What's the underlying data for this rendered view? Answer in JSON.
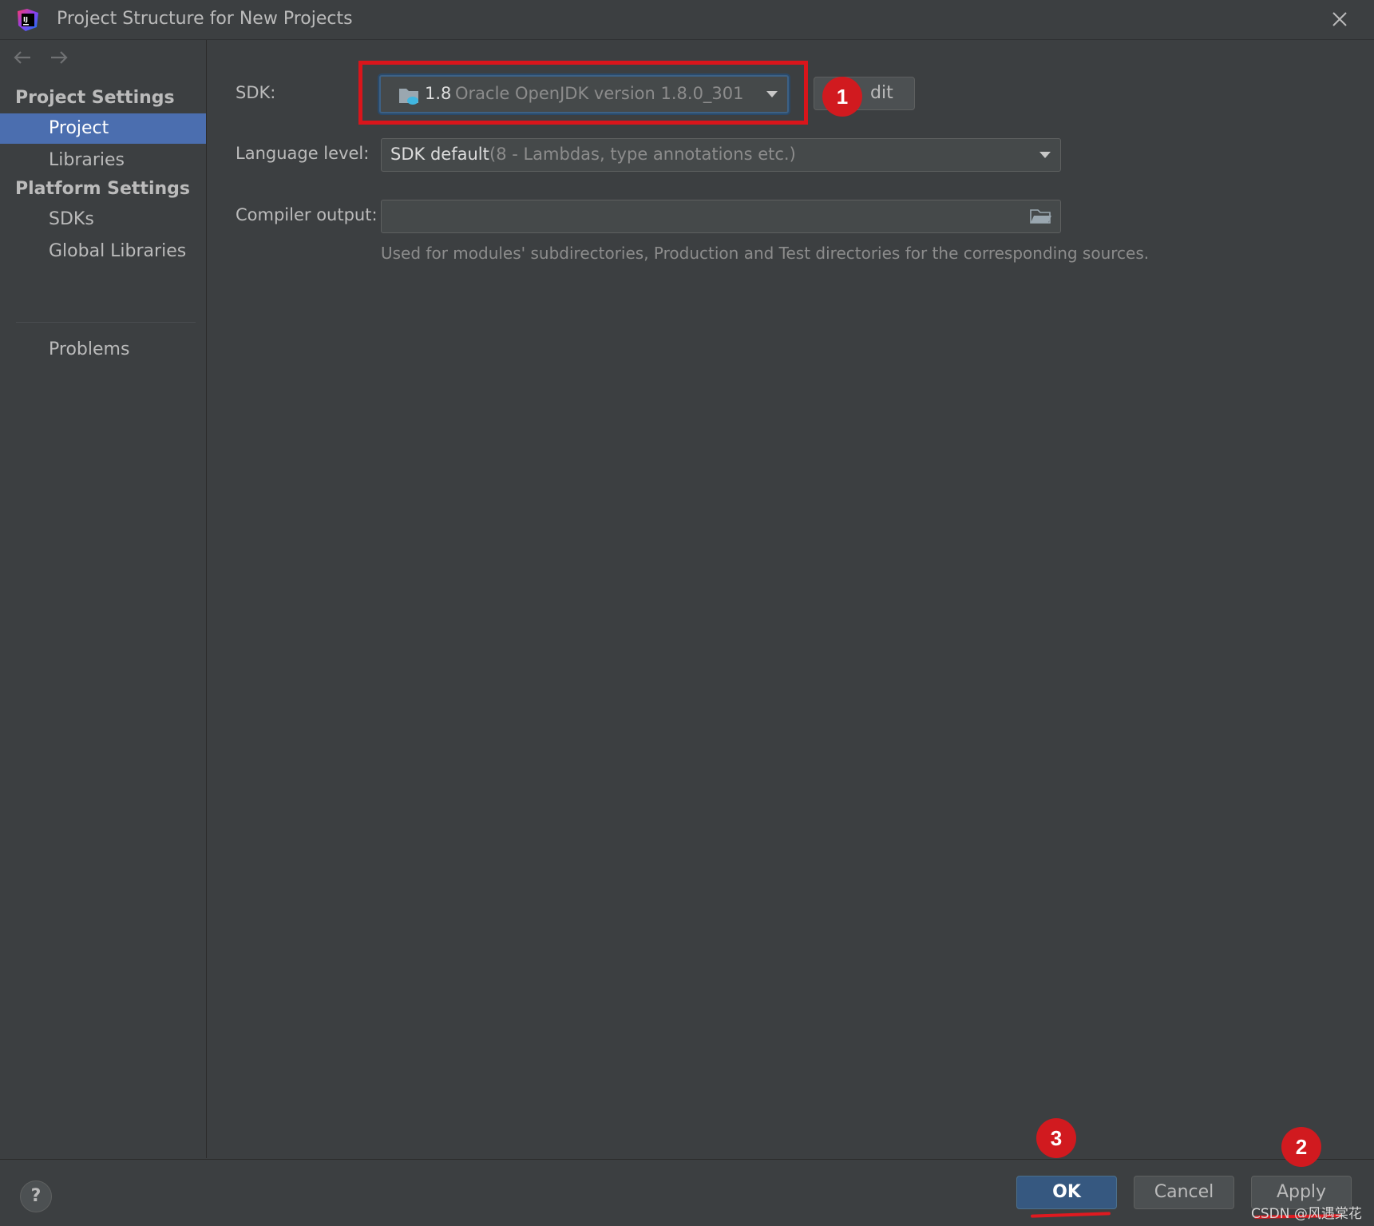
{
  "window": {
    "title": "Project Structure for New Projects"
  },
  "sidebar": {
    "project_settings_header": "Project Settings",
    "platform_settings_header": "Platform Settings",
    "items": [
      {
        "label": "Project",
        "selected": true
      },
      {
        "label": "Libraries",
        "selected": false
      },
      {
        "label": "SDKs",
        "selected": false
      },
      {
        "label": "Global Libraries",
        "selected": false
      },
      {
        "label": "Problems",
        "selected": false
      }
    ]
  },
  "form": {
    "sdk_label": "SDK:",
    "sdk_version": "1.8",
    "sdk_name": "Oracle OpenJDK version 1.8.0_301",
    "edit_button_label": "dit",
    "language_level_label": "Language level:",
    "language_level_value": "SDK default",
    "language_level_detail": "(8 - Lambdas, type annotations etc.)",
    "compiler_output_label": "Compiler output:",
    "compiler_output_value": "",
    "compiler_output_hint": "Used for modules' subdirectories, Production and Test directories for the corresponding sources."
  },
  "annotations": {
    "badge_1": "1",
    "badge_2": "2",
    "badge_3": "3"
  },
  "buttons": {
    "ok": "OK",
    "cancel": "Cancel",
    "apply": "Apply",
    "help": "?"
  },
  "watermark": "CSDN @风遇棠花",
  "colors": {
    "background": "#3c3f41",
    "selection": "#4b6eaf",
    "annotation_red": "#d9151b",
    "default_button": "#365880"
  }
}
